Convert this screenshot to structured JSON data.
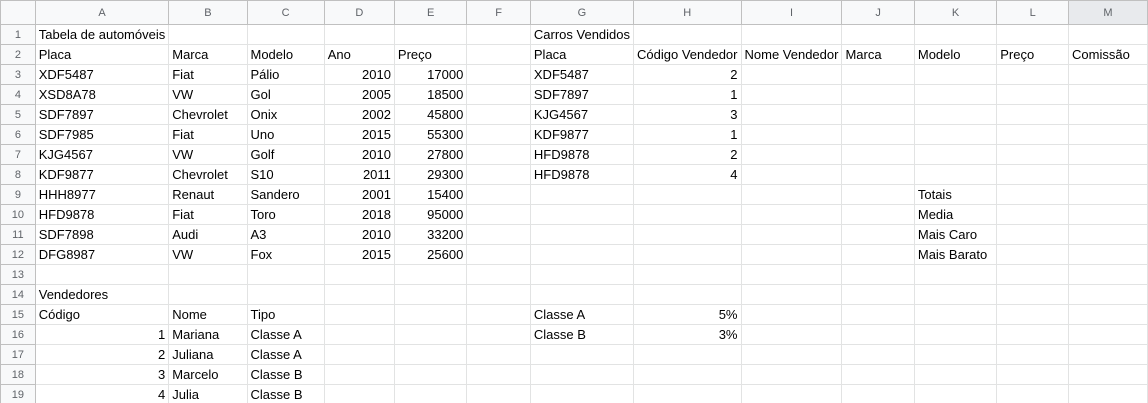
{
  "columns": [
    "A",
    "B",
    "C",
    "D",
    "E",
    "F",
    "G",
    "H",
    "I",
    "J",
    "K",
    "L",
    "M"
  ],
  "rows": [
    [
      "Tabela de automóveis",
      "",
      "",
      "",
      "",
      "",
      "Carros Vendidos",
      "",
      "",
      "",
      "",
      "",
      ""
    ],
    [
      "Placa",
      "Marca",
      "Modelo",
      "Ano",
      "Preço",
      "",
      "Placa",
      "Código Vendedor",
      "Nome Vendedor",
      "Marca",
      "Modelo",
      "Preço",
      "Comissão"
    ],
    [
      "XDF5487",
      "Fiat",
      "Pálio",
      "2010",
      "17000",
      "",
      "XDF5487",
      "2",
      "",
      "",
      "",
      "",
      ""
    ],
    [
      "XSD8A78",
      "VW",
      "Gol",
      "2005",
      "18500",
      "",
      "SDF7897",
      "1",
      "",
      "",
      "",
      "",
      ""
    ],
    [
      "SDF7897",
      "Chevrolet",
      "Onix",
      "2002",
      "45800",
      "",
      "KJG4567",
      "3",
      "",
      "",
      "",
      "",
      ""
    ],
    [
      "SDF7985",
      "Fiat",
      "Uno",
      "2015",
      "55300",
      "",
      "KDF9877",
      "1",
      "",
      "",
      "",
      "",
      ""
    ],
    [
      "KJG4567",
      "VW",
      "Golf",
      "2010",
      "27800",
      "",
      "HFD9878",
      "2",
      "",
      "",
      "",
      "",
      ""
    ],
    [
      "KDF9877",
      "Chevrolet",
      "S10",
      "2011",
      "29300",
      "",
      "HFD9878",
      "4",
      "",
      "",
      "",
      "",
      ""
    ],
    [
      "HHH8977",
      "Renaut",
      "Sandero",
      "2001",
      "15400",
      "",
      "",
      "",
      "",
      "",
      "Totais",
      "",
      ""
    ],
    [
      "HFD9878",
      "Fiat",
      "Toro",
      "2018",
      "95000",
      "",
      "",
      "",
      "",
      "",
      "Media",
      "",
      ""
    ],
    [
      "SDF7898",
      "Audi",
      "A3",
      "2010",
      "33200",
      "",
      "",
      "",
      "",
      "",
      "Mais Caro",
      "",
      ""
    ],
    [
      "DFG8987",
      "VW",
      "Fox",
      "2015",
      "25600",
      "",
      "",
      "",
      "",
      "",
      "Mais Barato",
      "",
      ""
    ],
    [
      "",
      "",
      "",
      "",
      "",
      "",
      "",
      "",
      "",
      "",
      "",
      "",
      ""
    ],
    [
      "Vendedores",
      "",
      "",
      "",
      "",
      "",
      "",
      "",
      "",
      "",
      "",
      "",
      ""
    ],
    [
      "Código",
      "Nome",
      "Tipo",
      "",
      "",
      "",
      "Classe A",
      "5%",
      "",
      "",
      "",
      "",
      ""
    ],
    [
      "1",
      "Mariana",
      "Classe A",
      "",
      "",
      "",
      "Classe B",
      "3%",
      "",
      "",
      "",
      "",
      ""
    ],
    [
      "2",
      "Juliana",
      "Classe A",
      "",
      "",
      "",
      "",
      "",
      "",
      "",
      "",
      "",
      ""
    ],
    [
      "3",
      "Marcelo",
      "Classe B",
      "",
      "",
      "",
      "",
      "",
      "",
      "",
      "",
      "",
      ""
    ],
    [
      "4",
      "Julia",
      "Classe B",
      "",
      "",
      "",
      "",
      "",
      "",
      "",
      "",
      "",
      ""
    ]
  ]
}
